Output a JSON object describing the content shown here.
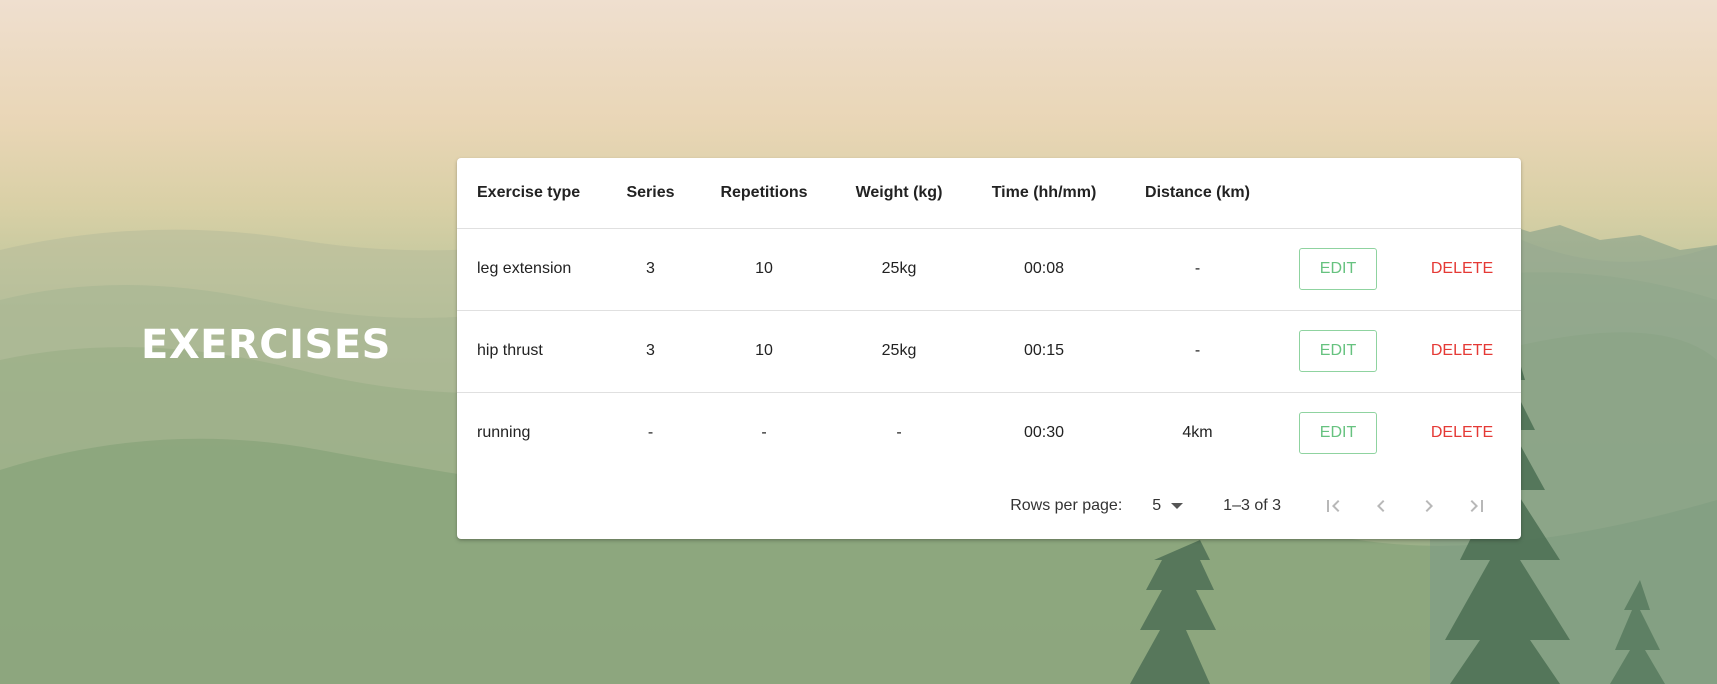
{
  "page": {
    "title": "EXERCISES"
  },
  "table": {
    "headers": [
      "Exercise type",
      "Series",
      "Repetitions",
      "Weight (kg)",
      "Time (hh/mm)",
      "Distance (km)"
    ],
    "rows": [
      {
        "type": "leg extension",
        "series": "3",
        "repetitions": "10",
        "weight": "25kg",
        "time": "00:08",
        "distance": "-"
      },
      {
        "type": "hip thrust",
        "series": "3",
        "repetitions": "10",
        "weight": "25kg",
        "time": "00:15",
        "distance": "-"
      },
      {
        "type": "running",
        "series": "-",
        "repetitions": "-",
        "weight": "-",
        "time": "00:30",
        "distance": "4km"
      }
    ],
    "actions": {
      "edit_label": "EDIT",
      "delete_label": "DELETE"
    }
  },
  "pagination": {
    "rows_per_page_label": "Rows per page:",
    "rows_per_page_value": "5",
    "range_text": "1–3 of 3",
    "icons": [
      "first-page-icon",
      "prev-page-icon",
      "next-page-icon",
      "last-page-icon"
    ]
  },
  "colors": {
    "edit": "#66c27f",
    "delete": "#e53935"
  }
}
